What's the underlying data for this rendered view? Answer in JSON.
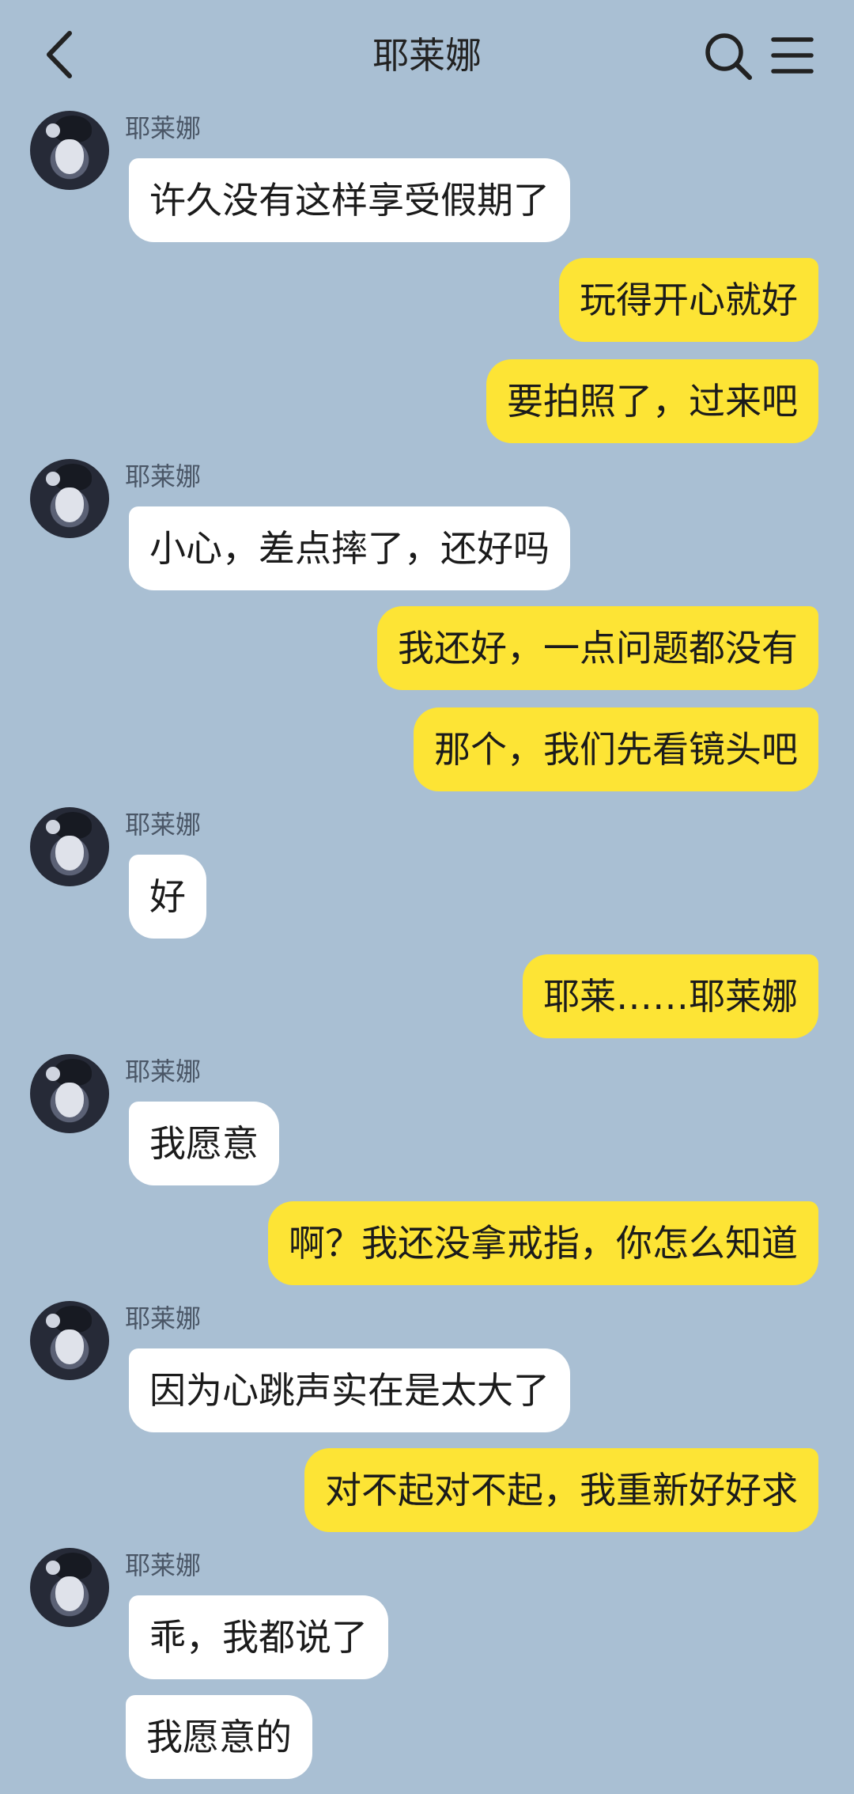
{
  "header": {
    "title": "耶莱娜",
    "back_icon": "chevron-left-icon",
    "search_icon": "search-icon",
    "menu_icon": "menu-icon"
  },
  "colors": {
    "background": "#a9bfd3",
    "incoming_bubble": "#ffffff",
    "outgoing_bubble": "#fde435"
  },
  "messages": [
    {
      "side": "left",
      "sender": "耶莱娜",
      "text": "许久没有这样享受假期了"
    },
    {
      "side": "right",
      "text": "玩得开心就好"
    },
    {
      "side": "right",
      "text": "要拍照了，过来吧"
    },
    {
      "side": "left",
      "sender": "耶莱娜",
      "text": "小心，差点摔了，还好吗"
    },
    {
      "side": "right",
      "text": "我还好，一点问题都没有"
    },
    {
      "side": "right",
      "text": "那个，我们先看镜头吧"
    },
    {
      "side": "left",
      "sender": "耶莱娜",
      "text": "好"
    },
    {
      "side": "right",
      "text": "耶莱……耶莱娜"
    },
    {
      "side": "left",
      "sender": "耶莱娜",
      "text": "我愿意"
    },
    {
      "side": "right",
      "text": "啊？我还没拿戒指，你怎么知道"
    },
    {
      "side": "left",
      "sender": "耶莱娜",
      "text": "因为心跳声实在是太大了"
    },
    {
      "side": "right",
      "text": "对不起对不起，我重新好好求"
    },
    {
      "side": "left",
      "sender": "耶莱娜",
      "text": "乖，我都说了"
    },
    {
      "side": "left",
      "text": "我愿意的"
    }
  ]
}
